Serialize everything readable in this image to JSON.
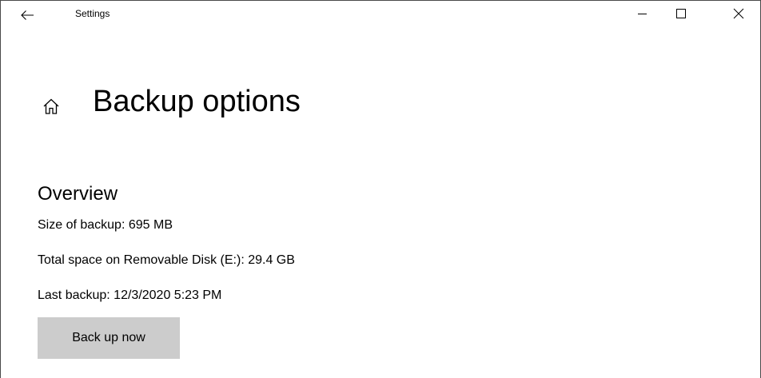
{
  "window": {
    "app_title": "Settings",
    "back_icon": "arrow-left-icon",
    "minimize_icon": "minimize-icon",
    "maximize_icon": "maximize-icon",
    "close_icon": "close-icon"
  },
  "page": {
    "home_icon": "home-icon",
    "title": "Backup options"
  },
  "overview": {
    "heading": "Overview",
    "size_of_backup": "Size of backup: 695 MB",
    "total_space": "Total space on Removable Disk (E:): 29.4 GB",
    "last_backup": "Last backup: 12/3/2020 5:23 PM",
    "backup_button_label": "Back up now"
  },
  "colors": {
    "background": "#ffffff",
    "button_background": "#cccccc",
    "text": "#000000",
    "border": "#4a4a4a"
  }
}
